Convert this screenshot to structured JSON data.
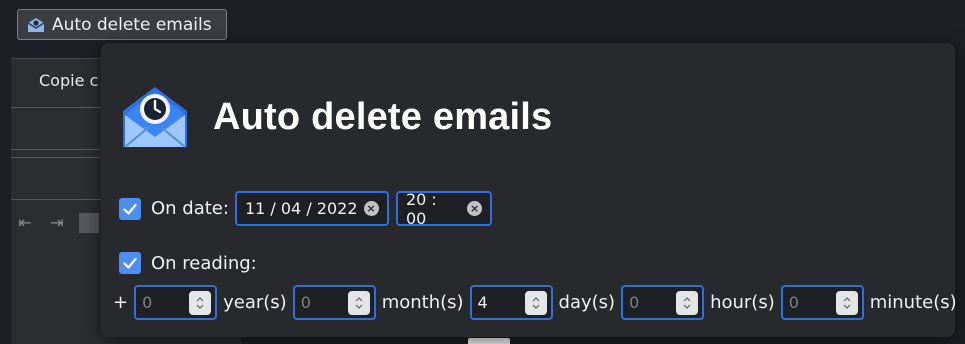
{
  "toolbar": {
    "auto_delete_button": "Auto delete emails"
  },
  "compose": {
    "field_label": "Copie c"
  },
  "dialog": {
    "title": "Auto delete emails",
    "on_date": {
      "checked": true,
      "label": "On date:",
      "date_value": "11 / 04 / 2022",
      "time_value": "20 : 00"
    },
    "on_reading": {
      "checked": true,
      "label": "On reading:",
      "prefix": "+",
      "fields": [
        {
          "value": "0",
          "unit": "year(s)"
        },
        {
          "value": "0",
          "unit": "month(s)"
        },
        {
          "value": "4",
          "unit": "day(s)"
        },
        {
          "value": "0",
          "unit": "hour(s)"
        },
        {
          "value": "0",
          "unit": "minute(s)"
        }
      ]
    }
  },
  "icons": {
    "logo": "envelope-clock-icon",
    "check": "checkmark-icon",
    "clear": "clear-x-icon",
    "spinner": "spinner-updown-icon"
  },
  "colors": {
    "accent": "#2f6fe0",
    "checkbox": "#4d8ef2",
    "panel_bg": "#28292d"
  }
}
